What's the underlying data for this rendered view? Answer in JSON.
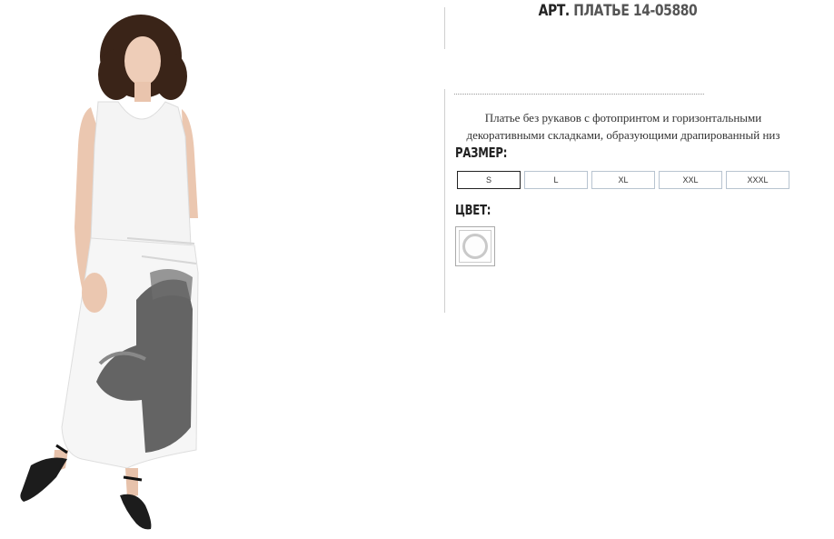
{
  "product": {
    "title_prefix": "АРТ.",
    "title_name": "ПЛАТЬЕ 14-05880",
    "description": "Платье без рукавов с фотопринтом и горизонтальными декоративными складками, образующими драпированный низ"
  },
  "size": {
    "label": "РАЗМЕР:",
    "options": [
      "S",
      "L",
      "XL",
      "XXL",
      "XXXL"
    ],
    "selected": "S"
  },
  "color": {
    "label": "ЦВЕТ:",
    "swatches": [
      {
        "name": "white",
        "hex": "#ffffff"
      }
    ]
  },
  "image": {
    "subject": "model-wearing-white-sleeveless-dress"
  }
}
